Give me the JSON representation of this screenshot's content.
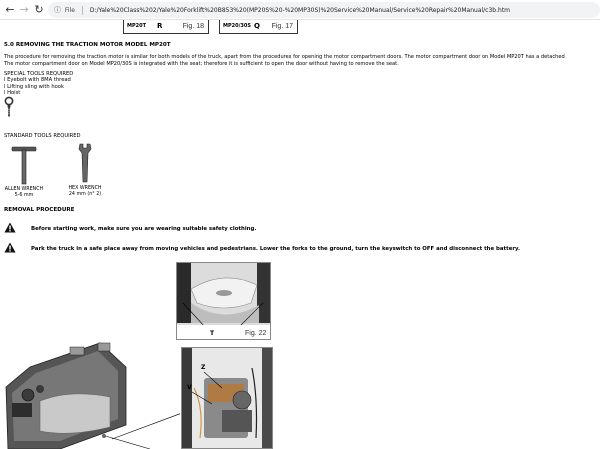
{
  "browser": {
    "back_icon": "back-arrow-icon",
    "forward_icon": "forward-arrow-icon",
    "reload_icon": "reload-icon",
    "file_label": "File",
    "url": "D:/Yale%20Class%202/Yale%20Forklift%20B853%20(MP20S%20-%20MP30S)%20Service%20Manual/Service%20Repair%20Manual/c3b.htm"
  },
  "figures_top": [
    {
      "code": "MP20T",
      "letter": "R",
      "caption": "Fig. 18"
    },
    {
      "code": "MP20/30S",
      "letter": "Q",
      "caption": "Fig. 17"
    }
  ],
  "section": {
    "title": "5.0 REMOVING THE TRACTION MOTOR MODEL MP20T",
    "paragraph_line1": "The procedure for removing the traction motor is similar for both models of the truck, apart from the procedures for opening the motor compartment doors. The motor compartment door on Model MP20T has a detached",
    "paragraph_line2": "The motor compartment door on Model MP20/30S is integrated with the seat; therefore it is sufficient to open the door without having to remove the seat."
  },
  "special_tools": {
    "heading": "SPECIAL TOOLS REQUIRED",
    "items": [
      "l Eyebolt with 8MA thread",
      "l Lifting sling with hook",
      "l Hoist"
    ]
  },
  "standard_tools": {
    "heading": "STANDARD TOOLS REQUIRED",
    "allen": {
      "label": "ALLEN WRENCH",
      "size": "5-6 mm"
    },
    "hex": {
      "label": "HEX WRENCH",
      "size": "24 mm (n° 2)"
    }
  },
  "removal": {
    "heading": "REMOVAL PROCEDURE",
    "warnings": [
      "Before starting work, make sure you are wearing suitable safety clothing.",
      "Park the truck in a safe place away from moving vehicles and pedestrians. Lower the forks to the ground, turn the keyswitch to OFF and disconnect the battery."
    ]
  },
  "photos": {
    "fig22": {
      "caption": "Fig. 22",
      "label_t": "T"
    },
    "fig23": {
      "label_z": "Z",
      "label_v": "V"
    }
  }
}
